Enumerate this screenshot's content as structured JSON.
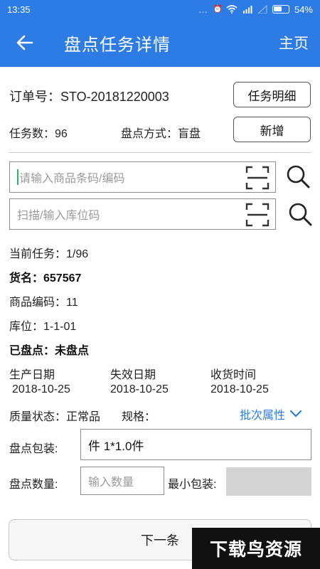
{
  "status_bar": {
    "time": "13:35",
    "icons_text": "…",
    "battery_percent": "54%"
  },
  "app_bar": {
    "title": "盘点任务详情",
    "home_label": "主页"
  },
  "order": {
    "order_label": "订单号：STO-20181220003",
    "task_count_label": "任务数：96",
    "method_label": "盘点方式：盲盘",
    "task_detail_button": "任务明细",
    "add_button": "新增"
  },
  "inputs": {
    "barcode_placeholder": "请输入商品条码/编码",
    "location_placeholder": "扫描/输入库位码"
  },
  "details": {
    "current_task": "当前任务：1/96",
    "goods_name": "货名：657567",
    "goods_code": "商品编码：11",
    "location": "库位：1-1-01",
    "counted": "已盘点：未盘点"
  },
  "dates": {
    "production_label": "生产日期",
    "production_value": "2018-10-25",
    "expiry_label": "失效日期",
    "expiry_value": "2018-10-25",
    "receive_label": "收货时间",
    "receive_value": "2018-10-25"
  },
  "quality": {
    "status_label": "质量状态：正常品",
    "spec_label": "规格：",
    "batch_link": "批次属性"
  },
  "count_form": {
    "package_label": "盘点包装:",
    "package_value": "件 1*1.0件",
    "qty_label": "盘点数量:",
    "qty_placeholder": "输入数量",
    "min_pack_label": "最小包装:"
  },
  "footer": {
    "next_button": "下一条",
    "watermark_text": "下载鸟资源"
  },
  "colors": {
    "accent": "#2d7be4",
    "border": "#8e8e8e",
    "disabled": "#d4d4d4"
  },
  "icons": [
    "back-arrow-icon",
    "scan-icon",
    "search-icon",
    "chevron-down-icon",
    "battery-icon",
    "wifi-icon",
    "signal-icon"
  ]
}
